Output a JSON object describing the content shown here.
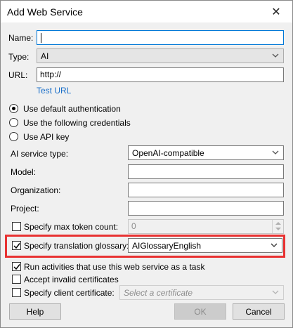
{
  "window": {
    "title": "Add Web Service",
    "close_glyph": "✕"
  },
  "fields": {
    "name_label": "Name:",
    "name_value": "",
    "type_label": "Type:",
    "type_value": "AI",
    "url_label": "URL:",
    "url_value": "http://",
    "test_url_link": "Test URL"
  },
  "auth": {
    "options": [
      "Use default authentication",
      "Use the following credentials",
      "Use API key"
    ],
    "selected_index": 0
  },
  "ai": {
    "service_type_label": "AI service type:",
    "service_type_value": "OpenAI-compatible",
    "model_label": "Model:",
    "model_value": "",
    "organization_label": "Organization:",
    "organization_value": "",
    "project_label": "Project:",
    "project_value": "",
    "max_token_label": "Specify max token count:",
    "max_token_checked": false,
    "max_token_value": "0",
    "glossary_label": "Specify translation glossary:",
    "glossary_checked": true,
    "glossary_value": "AIGlossaryEnglish"
  },
  "options": {
    "run_activities_label": "Run activities that use this web service as a task",
    "run_activities_checked": true,
    "accept_invalid_label": "Accept invalid certificates",
    "accept_invalid_checked": false,
    "client_cert_label": "Specify client certificate:",
    "client_cert_checked": false,
    "client_cert_placeholder": "Select a certificate"
  },
  "buttons": {
    "help": "Help",
    "ok": "OK",
    "cancel": "Cancel"
  },
  "colors": {
    "highlight": "#e83232",
    "link": "#1a6fc9"
  },
  "icons": {
    "close": "close-icon",
    "dropdown": "chevron-down-icon",
    "check": "checkmark-icon",
    "spinner": "spinner-arrows-icon"
  }
}
